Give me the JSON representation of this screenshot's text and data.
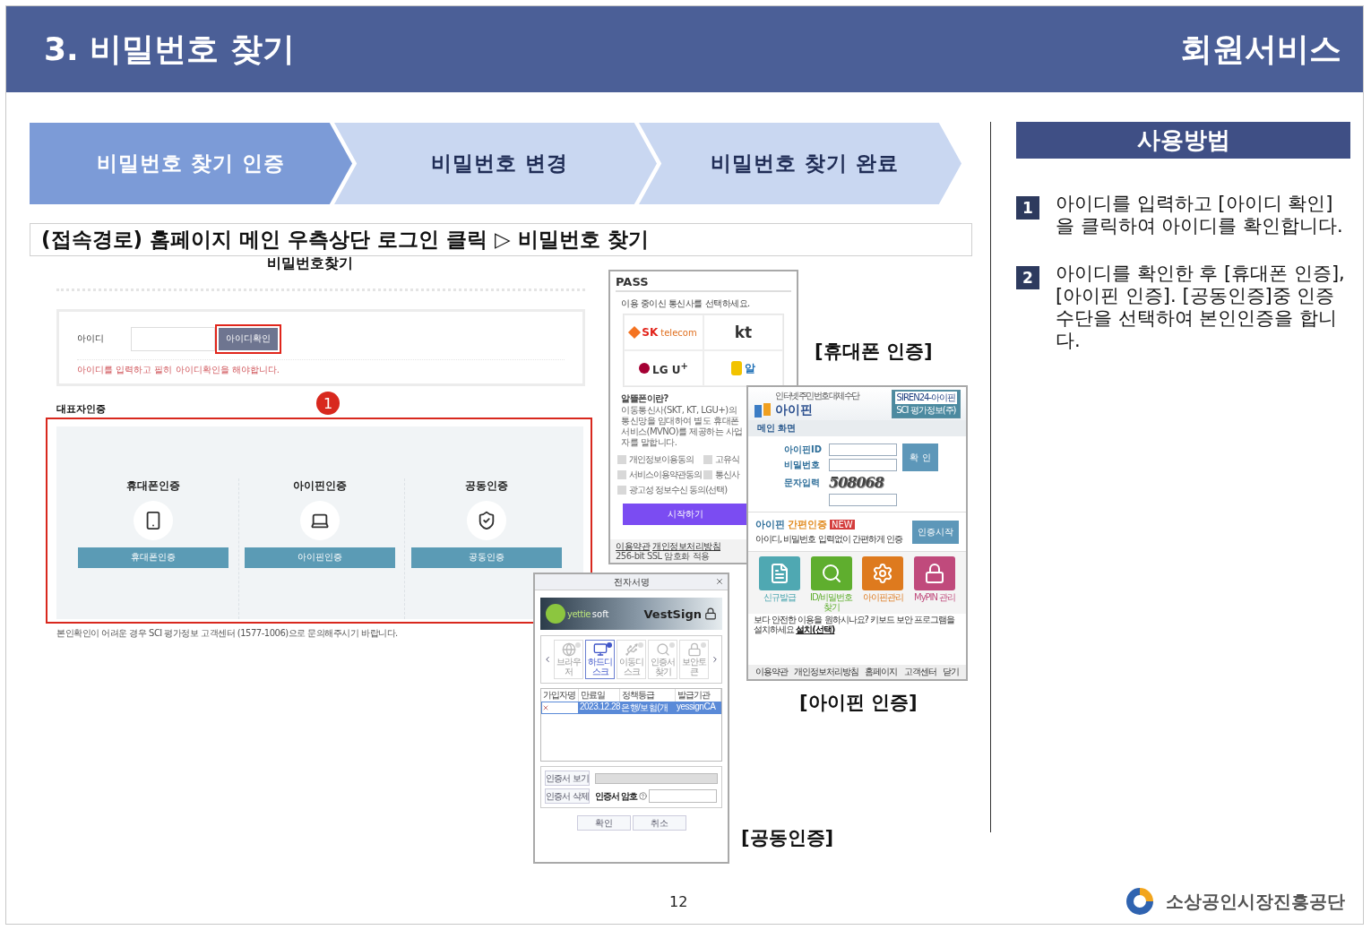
{
  "header": {
    "title": "3. 비밀번호 찾기",
    "section": "회원서비스"
  },
  "steps": [
    {
      "label": "비밀번호 찾기 인증",
      "selected": true
    },
    {
      "label": "비밀번호 변경",
      "selected": false
    },
    {
      "label": "비밀번호 찾기 완료",
      "selected": false
    }
  ],
  "route": "(접속경로) 홈페이지 메인 우측상단 로그인 클릭 ▷ 비밀번호 찾기",
  "web_form": {
    "title": "비밀번호찾기",
    "id_label": "아이디",
    "check_button": "아이디확인",
    "hint": "아이디를 입력하고 필히 아이디확인을 해야합니다.",
    "callout": "1",
    "section_title": "대표자인증",
    "methods": [
      {
        "kind": "phone",
        "title": "휴대폰인증",
        "button": "휴대폰인증"
      },
      {
        "kind": "ipin",
        "title": "아이핀인증",
        "button": "아이핀인증"
      },
      {
        "kind": "cert",
        "title": "공동인증",
        "button": "공동인증"
      }
    ],
    "note": "본인확인이 어려운 경우 SCI 평가정보 고객센터 (1577-1006)으로 문의해주시기 바랍니다."
  },
  "pass": {
    "title": "PASS",
    "prompt": "이용 중이신 통신사를 선택하세요.",
    "carriers": [
      {
        "kind": "sk",
        "name": "SK",
        "sub": "telecom"
      },
      {
        "kind": "kt",
        "name": "kt"
      },
      {
        "kind": "lg",
        "name": "LG U$^{+}$"
      },
      {
        "kind": "mvno",
        "name": "알"
      }
    ],
    "mvno_title": "알뜰폰이란?",
    "mvno_text": "이동통신사(SKT, KT, LGU+)의 통신망을 임대하여 별도 휴대폰 서비스(MVNO)를 제공하는 사업자를 말합니다.",
    "agreements": [
      {
        "label": "개인정보이용동의",
        "checked": false
      },
      {
        "label": "고유식",
        "checked": false
      },
      {
        "label": "서비스이용약관동의",
        "checked": false
      },
      {
        "label": "통신사",
        "checked": false
      },
      {
        "label": "광고성 정보수신 동의(선택)",
        "checked": false
      }
    ],
    "start_button": "시작하기",
    "footer_links": [
      "이용약관",
      "개인정보처리방침"
    ],
    "footer_note": "256-bit SSL 암호화 적용",
    "caption": "[휴대폰 인증]"
  },
  "ipin": {
    "tagline": "인터넷주민번호대체수단",
    "brand": "아이핀",
    "badge": "SIREN24-아이핀",
    "badge_sub": "SCI 평가정보(주)",
    "tab": "메인 화면",
    "fields": [
      {
        "label": "아이핀ID"
      },
      {
        "label": "비밀번호"
      },
      {
        "label": "문자입력"
      }
    ],
    "confirm_button": "확 인",
    "captcha": "508068",
    "easy_title": "아이핀",
    "easy_accent": "간편인증",
    "new_badge": "NEW",
    "easy_text": "아이디, 비밀번호 입력없이 간편하게 인증",
    "easy_button": "인증시작",
    "tiles": [
      {
        "kind": "issue",
        "label": "신규발급",
        "color": "#4fa8b2"
      },
      {
        "kind": "find",
        "label": "ID/비밀번호찾기",
        "color": "#5fae2e"
      },
      {
        "kind": "manage",
        "label": "아이핀관리",
        "color": "#de7a1e"
      },
      {
        "kind": "mypin",
        "label": "MyPIN 관리",
        "color": "#c04a7c"
      }
    ],
    "notice": "보다 안전한 이용을 원하시나요? 키보드 보안 프로그램을 설치하세요",
    "notice_link": "설치(선택)",
    "footer_links": [
      "이용약관",
      "개인정보처리방침",
      "홈페이지",
      "고객센터",
      "닫기"
    ],
    "caption": "[아이핀 인증]"
  },
  "vestsign": {
    "title": "전자서명",
    "vendor": "yettie",
    "vendor_sub": "soft",
    "product": "VestSign",
    "media": [
      {
        "kind": "browser",
        "label": "브라우저",
        "selected": false
      },
      {
        "kind": "disk",
        "label": "하드디스크",
        "selected": true
      },
      {
        "kind": "usb",
        "label": "이동디스크",
        "selected": false
      },
      {
        "kind": "find",
        "label": "인증서찾기",
        "selected": false
      },
      {
        "kind": "token",
        "label": "보안토큰",
        "selected": false
      }
    ],
    "columns": [
      "가입자명",
      "만료일",
      "정책등급",
      "발급기관"
    ],
    "rows": [
      {
        "expiry": "2023.12.28",
        "policy": "은행/보험(개",
        "issuer": "yessignCA",
        "selected": true
      }
    ],
    "view_button": "인증서 보기",
    "delete_button": "인증서 삭제",
    "password_label": "인증서 암호",
    "ok_button": "확인",
    "cancel_button": "취소",
    "caption": "[공동인증]"
  },
  "usage": {
    "title": "사용방법",
    "items": [
      {
        "number": "1",
        "text": "아이디를 입력하고 [아이디 확인]을 클릭하여 아이디를 확인합니다."
      },
      {
        "number": "2",
        "text": "아이디를 확인한 후  [휴대폰 인증], [아이핀 인증]. [공동인증]중 인증수단을 선택하여 본인인증을 합니다."
      }
    ]
  },
  "page_number": "12",
  "organization": "소상공인시장진흥공단"
}
